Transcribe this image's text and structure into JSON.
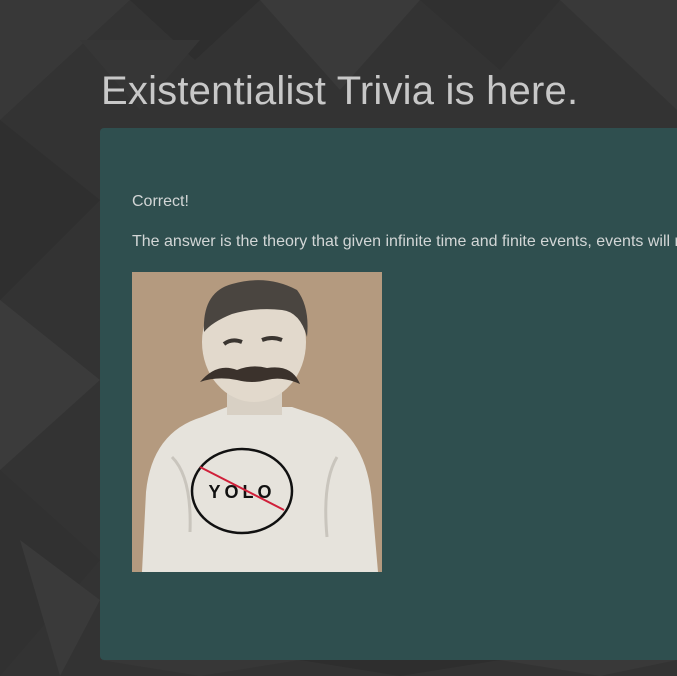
{
  "page": {
    "title": "Existentialist Trivia is here."
  },
  "result": {
    "status": "Correct!",
    "explanation": "The answer is the theory that given infinite time and finite events, events will r"
  },
  "image": {
    "subject": "portrait-illustration",
    "shirt_text": "YOLO"
  },
  "colors": {
    "background": "#333333",
    "card": "#2f4f4f",
    "title_text": "#c8c8c8",
    "body_text": "#d2d6d6",
    "image_background": "#b49a7f"
  }
}
